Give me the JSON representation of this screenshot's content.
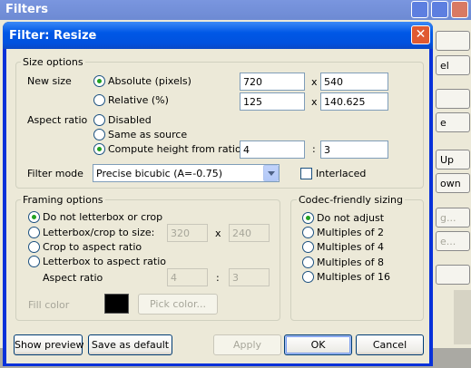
{
  "background_window": {
    "title": "Filters",
    "side_buttons": [
      "",
      "el",
      "",
      "e",
      "Up",
      "own",
      "g...",
      "e...",
      ""
    ]
  },
  "dialog": {
    "title": "Filter: Resize",
    "size_options": {
      "legend": "Size options",
      "new_size_label": "New size",
      "absolute_label": "Absolute (pixels)",
      "absolute_width": "720",
      "absolute_height": "540",
      "relative_label": "Relative (%)",
      "relative_width": "125",
      "relative_height": "140.625",
      "x_sep": "x",
      "aspect_ratio_label": "Aspect ratio",
      "ar_disabled": "Disabled",
      "ar_same": "Same as source",
      "ar_compute": "Compute height from ratio:",
      "ratio_num": "4",
      "ratio_den": "3",
      "colon": ":",
      "filter_mode_label": "Filter mode",
      "filter_mode_value": "Precise bicubic (A=-0.75)",
      "interlaced_label": "Interlaced",
      "interlaced": false
    },
    "framing_options": {
      "legend": "Framing options",
      "opt_none": "Do not letterbox or crop",
      "opt_letterbox_crop": "Letterbox/crop to size:",
      "lb_width": "320",
      "lb_height": "240",
      "x_sep": "x",
      "opt_crop_aspect": "Crop to aspect ratio",
      "opt_letterbox_aspect": "Letterbox to aspect ratio",
      "aspect_ratio_label": "Aspect ratio",
      "ar_num": "4",
      "ar_den": "3",
      "colon": ":",
      "fill_color_label": "Fill color",
      "fill_color": "#000000",
      "pick_color_label": "Pick color..."
    },
    "codec_sizing": {
      "legend": "Codec-friendly sizing",
      "options": [
        "Do not adjust",
        "Multiples of 2",
        "Multiples of 4",
        "Multiples of 8",
        "Multiples of 16"
      ],
      "selected": "Do not adjust"
    },
    "buttons": {
      "show_preview": "Show preview",
      "save_default": "Save as default",
      "apply": "Apply",
      "ok": "OK",
      "cancel": "Cancel"
    }
  }
}
